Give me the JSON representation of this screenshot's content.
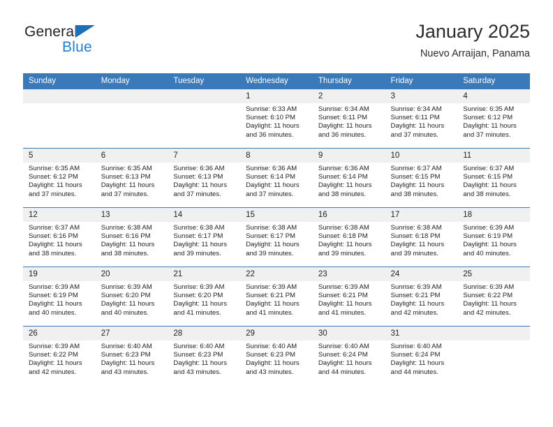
{
  "brand": {
    "name_top": "General",
    "name_bottom": "Blue",
    "accent_color": "#1d7fd0",
    "triangle_color": "#1d6fb8"
  },
  "header": {
    "title": "January 2025",
    "subtitle": "Nuevo Arraijan, Panama",
    "header_bg": "#3a79ba",
    "daynum_bg": "#f0f0f0"
  },
  "weekdays": [
    "Sunday",
    "Monday",
    "Tuesday",
    "Wednesday",
    "Thursday",
    "Friday",
    "Saturday"
  ],
  "labels": {
    "sunrise": "Sunrise:",
    "sunset": "Sunset:",
    "daylight": "Daylight:"
  },
  "weeks": [
    [
      {
        "day": "",
        "empty": true
      },
      {
        "day": "",
        "empty": true
      },
      {
        "day": "",
        "empty": true
      },
      {
        "day": "1",
        "sunrise": "Sunrise: 6:33 AM",
        "sunset": "Sunset: 6:10 PM",
        "daylight1": "Daylight: 11 hours",
        "daylight2": "and 36 minutes."
      },
      {
        "day": "2",
        "sunrise": "Sunrise: 6:34 AM",
        "sunset": "Sunset: 6:11 PM",
        "daylight1": "Daylight: 11 hours",
        "daylight2": "and 36 minutes."
      },
      {
        "day": "3",
        "sunrise": "Sunrise: 6:34 AM",
        "sunset": "Sunset: 6:11 PM",
        "daylight1": "Daylight: 11 hours",
        "daylight2": "and 37 minutes."
      },
      {
        "day": "4",
        "sunrise": "Sunrise: 6:35 AM",
        "sunset": "Sunset: 6:12 PM",
        "daylight1": "Daylight: 11 hours",
        "daylight2": "and 37 minutes."
      }
    ],
    [
      {
        "day": "5",
        "sunrise": "Sunrise: 6:35 AM",
        "sunset": "Sunset: 6:12 PM",
        "daylight1": "Daylight: 11 hours",
        "daylight2": "and 37 minutes."
      },
      {
        "day": "6",
        "sunrise": "Sunrise: 6:35 AM",
        "sunset": "Sunset: 6:13 PM",
        "daylight1": "Daylight: 11 hours",
        "daylight2": "and 37 minutes."
      },
      {
        "day": "7",
        "sunrise": "Sunrise: 6:36 AM",
        "sunset": "Sunset: 6:13 PM",
        "daylight1": "Daylight: 11 hours",
        "daylight2": "and 37 minutes."
      },
      {
        "day": "8",
        "sunrise": "Sunrise: 6:36 AM",
        "sunset": "Sunset: 6:14 PM",
        "daylight1": "Daylight: 11 hours",
        "daylight2": "and 37 minutes."
      },
      {
        "day": "9",
        "sunrise": "Sunrise: 6:36 AM",
        "sunset": "Sunset: 6:14 PM",
        "daylight1": "Daylight: 11 hours",
        "daylight2": "and 38 minutes."
      },
      {
        "day": "10",
        "sunrise": "Sunrise: 6:37 AM",
        "sunset": "Sunset: 6:15 PM",
        "daylight1": "Daylight: 11 hours",
        "daylight2": "and 38 minutes."
      },
      {
        "day": "11",
        "sunrise": "Sunrise: 6:37 AM",
        "sunset": "Sunset: 6:15 PM",
        "daylight1": "Daylight: 11 hours",
        "daylight2": "and 38 minutes."
      }
    ],
    [
      {
        "day": "12",
        "sunrise": "Sunrise: 6:37 AM",
        "sunset": "Sunset: 6:16 PM",
        "daylight1": "Daylight: 11 hours",
        "daylight2": "and 38 minutes."
      },
      {
        "day": "13",
        "sunrise": "Sunrise: 6:38 AM",
        "sunset": "Sunset: 6:16 PM",
        "daylight1": "Daylight: 11 hours",
        "daylight2": "and 38 minutes."
      },
      {
        "day": "14",
        "sunrise": "Sunrise: 6:38 AM",
        "sunset": "Sunset: 6:17 PM",
        "daylight1": "Daylight: 11 hours",
        "daylight2": "and 39 minutes."
      },
      {
        "day": "15",
        "sunrise": "Sunrise: 6:38 AM",
        "sunset": "Sunset: 6:17 PM",
        "daylight1": "Daylight: 11 hours",
        "daylight2": "and 39 minutes."
      },
      {
        "day": "16",
        "sunrise": "Sunrise: 6:38 AM",
        "sunset": "Sunset: 6:18 PM",
        "daylight1": "Daylight: 11 hours",
        "daylight2": "and 39 minutes."
      },
      {
        "day": "17",
        "sunrise": "Sunrise: 6:38 AM",
        "sunset": "Sunset: 6:18 PM",
        "daylight1": "Daylight: 11 hours",
        "daylight2": "and 39 minutes."
      },
      {
        "day": "18",
        "sunrise": "Sunrise: 6:39 AM",
        "sunset": "Sunset: 6:19 PM",
        "daylight1": "Daylight: 11 hours",
        "daylight2": "and 40 minutes."
      }
    ],
    [
      {
        "day": "19",
        "sunrise": "Sunrise: 6:39 AM",
        "sunset": "Sunset: 6:19 PM",
        "daylight1": "Daylight: 11 hours",
        "daylight2": "and 40 minutes."
      },
      {
        "day": "20",
        "sunrise": "Sunrise: 6:39 AM",
        "sunset": "Sunset: 6:20 PM",
        "daylight1": "Daylight: 11 hours",
        "daylight2": "and 40 minutes."
      },
      {
        "day": "21",
        "sunrise": "Sunrise: 6:39 AM",
        "sunset": "Sunset: 6:20 PM",
        "daylight1": "Daylight: 11 hours",
        "daylight2": "and 41 minutes."
      },
      {
        "day": "22",
        "sunrise": "Sunrise: 6:39 AM",
        "sunset": "Sunset: 6:21 PM",
        "daylight1": "Daylight: 11 hours",
        "daylight2": "and 41 minutes."
      },
      {
        "day": "23",
        "sunrise": "Sunrise: 6:39 AM",
        "sunset": "Sunset: 6:21 PM",
        "daylight1": "Daylight: 11 hours",
        "daylight2": "and 41 minutes."
      },
      {
        "day": "24",
        "sunrise": "Sunrise: 6:39 AM",
        "sunset": "Sunset: 6:21 PM",
        "daylight1": "Daylight: 11 hours",
        "daylight2": "and 42 minutes."
      },
      {
        "day": "25",
        "sunrise": "Sunrise: 6:39 AM",
        "sunset": "Sunset: 6:22 PM",
        "daylight1": "Daylight: 11 hours",
        "daylight2": "and 42 minutes."
      }
    ],
    [
      {
        "day": "26",
        "sunrise": "Sunrise: 6:39 AM",
        "sunset": "Sunset: 6:22 PM",
        "daylight1": "Daylight: 11 hours",
        "daylight2": "and 42 minutes."
      },
      {
        "day": "27",
        "sunrise": "Sunrise: 6:40 AM",
        "sunset": "Sunset: 6:23 PM",
        "daylight1": "Daylight: 11 hours",
        "daylight2": "and 43 minutes."
      },
      {
        "day": "28",
        "sunrise": "Sunrise: 6:40 AM",
        "sunset": "Sunset: 6:23 PM",
        "daylight1": "Daylight: 11 hours",
        "daylight2": "and 43 minutes."
      },
      {
        "day": "29",
        "sunrise": "Sunrise: 6:40 AM",
        "sunset": "Sunset: 6:23 PM",
        "daylight1": "Daylight: 11 hours",
        "daylight2": "and 43 minutes."
      },
      {
        "day": "30",
        "sunrise": "Sunrise: 6:40 AM",
        "sunset": "Sunset: 6:24 PM",
        "daylight1": "Daylight: 11 hours",
        "daylight2": "and 44 minutes."
      },
      {
        "day": "31",
        "sunrise": "Sunrise: 6:40 AM",
        "sunset": "Sunset: 6:24 PM",
        "daylight1": "Daylight: 11 hours",
        "daylight2": "and 44 minutes."
      },
      {
        "day": "",
        "empty": true
      }
    ]
  ]
}
